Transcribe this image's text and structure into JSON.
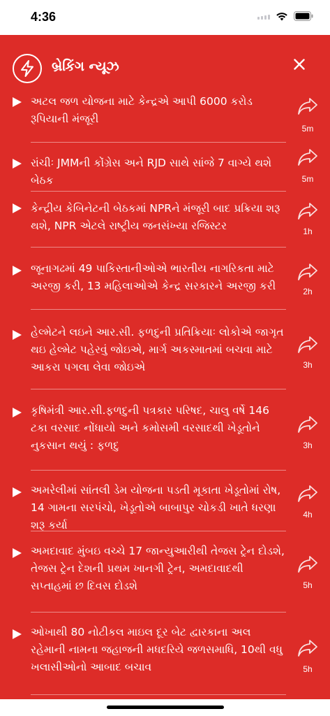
{
  "status_bar": {
    "time": "4:36"
  },
  "header": {
    "title": "બ્રેકિંગ ન્યૂઝ"
  },
  "news": [
    {
      "text": "અટલ જળ યોજના માટે કેન્દ્રએ આપી 6000 કરોડ રૂપિયાની મંજૂરી",
      "age": "5m"
    },
    {
      "text": "રાંચીઃ JMMની કોંગ્રેસ અને RJD સાથે સાંજે 7 વાગ્યે થશે બેઠક",
      "age": "5m"
    },
    {
      "text": "કેન્દ્રીય કેબિનેટની બેઠકમાં NPRને મંજૂરી બાદ પ્રક્રિયા શરૂ થશે, NPR એટલે રાષ્ટ્રીય જનસંખ્યા રજિસ્ટર",
      "age": "1h"
    },
    {
      "text": "જૂનાગઢમાં 49 પાકિસ્તાનીઓએ ભારતીય નાગરિકતા માટે અરજી કરી, 13 મહિલાઓએ કેન્દ્ર સરકારને અરજી કરી",
      "age": "2h"
    },
    {
      "text": "હેલ્મેટને લઇને આર.સી. ફળદુની પ્રતિક્રિયાઃ લોકોએ જાગૃત થઇ હેલ્મેટ પહેરવું જોઇએ, માર્ગ અકસ્માતમાં બચવા માટે આકરા પગલા લેવા જોઇએ",
      "age": "3h"
    },
    {
      "text": "કૃષિમંત્રી આર.સી.ફળદુની પત્રકાર પરિષદ, ચાલુ વર્ષે 146 ટકા વરસાદ નોંધાયો અને કમોસમી વરસાદથી ખેડૂતોને નુકસાન થયું : ફળદુ",
      "age": "3h"
    },
    {
      "text": "અમરેલીમાં સાંતલી ડેમ યોજના પડતી મૂકાતા ખેડૂતોમાં રોષ, 14 ગામના સરપંચો, ખેડૂતોએ બાબાપુર ચોકડી ખાતે ધરણા શરૂ કર્યા",
      "age": "4h"
    },
    {
      "text": "અમદાવાદ મુંબઇ વચ્ચે 17 જાન્યુઆરીથી તેજસ ટ્રેન દોડશે, તેજસ ટ્રેન દેશની પ્રથમ ખાનગી ટ્રેન, અમદાવાદથી સપ્તાહમાં છ દિવસ દોડશે",
      "age": "5h"
    },
    {
      "text": "ઓખાથી 80 નોટીકલ માઇલ દૂર બેટ દ્વારકાના અલ રહેમાની નામના જહાજની મધદરિયે જળસમાધિ, 10થી વધુ ખલાસીઓનો આબાદ બચાવ",
      "age": "5h"
    }
  ]
}
